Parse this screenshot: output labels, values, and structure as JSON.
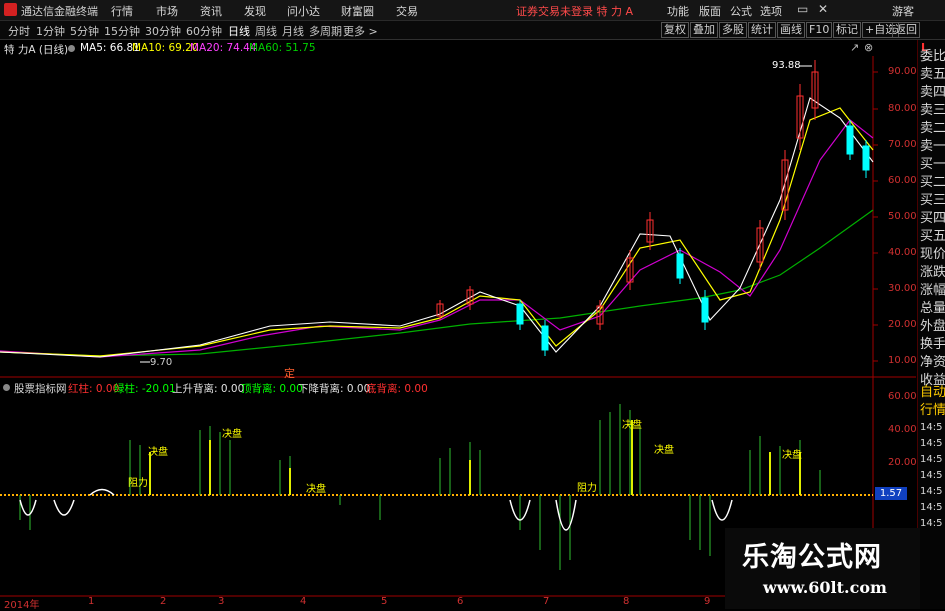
{
  "titlebar": {
    "app_name": "通达信金融终端",
    "menu": [
      "行情",
      "市场",
      "资讯",
      "发现",
      "问小达",
      "财富圈",
      "交易"
    ],
    "notice": "证券交易未登录  特 力 A",
    "tools": [
      "功能",
      "版面",
      "公式",
      "选项"
    ],
    "guest": "游客"
  },
  "periods": [
    "分时",
    "1分钟",
    "5分钟",
    "15分钟",
    "30分钟",
    "60分钟",
    "日线",
    "周线",
    "月线",
    "多周期",
    "更多 >"
  ],
  "active_period": "日线",
  "right_buttons": [
    "复权",
    "叠加",
    "多股",
    "统计",
    "画线",
    "F10",
    "标记",
    "+自选",
    "返回"
  ],
  "chart_info": {
    "stock": "特 力A (日线)",
    "ma5": "MA5: 66.81",
    "ma10": "MA10: 69.20",
    "ma20": "MA20: 74.44",
    "ma60": "MA60: 51.75"
  },
  "price_axis": [
    "90.00",
    "80.00",
    "70.00",
    "60.00",
    "50.00",
    "40.00",
    "30.00",
    "20.00",
    "10.00"
  ],
  "price_annotations": {
    "high": "93.88",
    "low": "9.70",
    "marker": "定"
  },
  "indicator": {
    "name": "股票指标网",
    "red": "红柱: 0.00",
    "green": "绿柱: -20.01",
    "up_div": "上升背离: 0.00",
    "top_div": "顶背离: 0.00",
    "down_div": "下降背离: 0.00",
    "bottom_div": "底背离: 0.00",
    "axis": [
      "60.00",
      "40.00",
      "20.00"
    ],
    "current": "1.57",
    "labels": [
      "阻力",
      "阻力",
      "决盘",
      "决盘",
      "决盘",
      "决盘",
      "决盘",
      "决盘"
    ]
  },
  "right_panel": {
    "corner": "L",
    "items": [
      "委比",
      "卖五",
      "卖四",
      "卖三",
      "卖二",
      "卖一",
      "买一",
      "买二",
      "买三",
      "买四",
      "买五",
      "现价",
      "涨跌",
      "涨幅",
      "总量",
      "外盘",
      "换手",
      "净资",
      "收益",
      "自动",
      "行情"
    ],
    "times": [
      "14:5",
      "14:5",
      "14:5",
      "14:5",
      "14:5",
      "14:5",
      "14:5"
    ]
  },
  "date_axis": [
    "2014年",
    "1",
    "2",
    "3",
    "4",
    "5",
    "6",
    "7",
    "8",
    "9"
  ],
  "watermark": {
    "title": "乐淘公式网",
    "url": "www.60lt.com"
  },
  "colors": {
    "up": "#ff3030",
    "down": "#00ffff",
    "ma5": "#ffffff",
    "ma10": "#ffff00",
    "ma20": "#ff00ff",
    "ma60": "#00c000",
    "axis": "#c00000"
  }
}
